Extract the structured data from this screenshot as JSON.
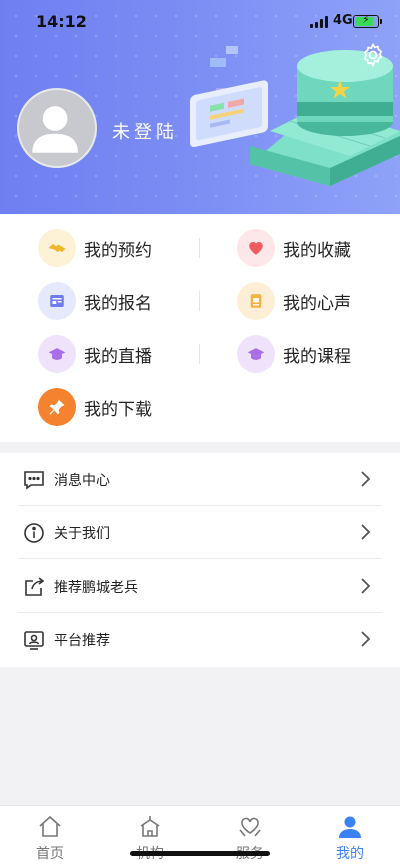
{
  "status_bar": {
    "time": "14:12",
    "network": "4G"
  },
  "profile": {
    "login_text": "未登陆"
  },
  "grid": [
    {
      "label": "我的预约",
      "icon": "handshake-icon",
      "bg": "#fdf1d6",
      "fg": "#f1b52c"
    },
    {
      "label": "我的收藏",
      "icon": "heart-icon",
      "bg": "#fde7e8",
      "fg": "#ee5a60"
    },
    {
      "label": "我的报名",
      "icon": "form-icon",
      "bg": "#e6e8fb",
      "fg": "#6f7cf0"
    },
    {
      "label": "我的心声",
      "icon": "note-icon",
      "bg": "#fdeed6",
      "fg": "#f1b143"
    },
    {
      "label": "我的直播",
      "icon": "graduation-cap-icon",
      "bg": "#efe3fb",
      "fg": "#a86de8"
    },
    {
      "label": "我的课程",
      "icon": "graduation-cap-icon",
      "bg": "#efe3fb",
      "fg": "#a86de8"
    },
    {
      "label": "我的下载",
      "icon": "pin-icon",
      "bg": "#f5822e",
      "fg": "#ffffff"
    }
  ],
  "list": [
    {
      "label": "消息中心",
      "icon": "message-icon"
    },
    {
      "label": "关于我们",
      "icon": "info-icon"
    },
    {
      "label": "推荐鹏城老兵",
      "icon": "share-icon"
    },
    {
      "label": "平台推荐",
      "icon": "id-card-icon"
    }
  ],
  "tabs": [
    {
      "label": "首页",
      "icon": "home-icon",
      "active": false
    },
    {
      "label": "机构",
      "icon": "building-icon",
      "active": false
    },
    {
      "label": "服务",
      "icon": "heart-hands-icon",
      "active": false
    },
    {
      "label": "我的",
      "icon": "person-icon",
      "active": true
    }
  ],
  "colors": {
    "header_start": "#6f7ff0",
    "header_end": "#8fa2f8",
    "active_tab": "#3b82f6"
  }
}
